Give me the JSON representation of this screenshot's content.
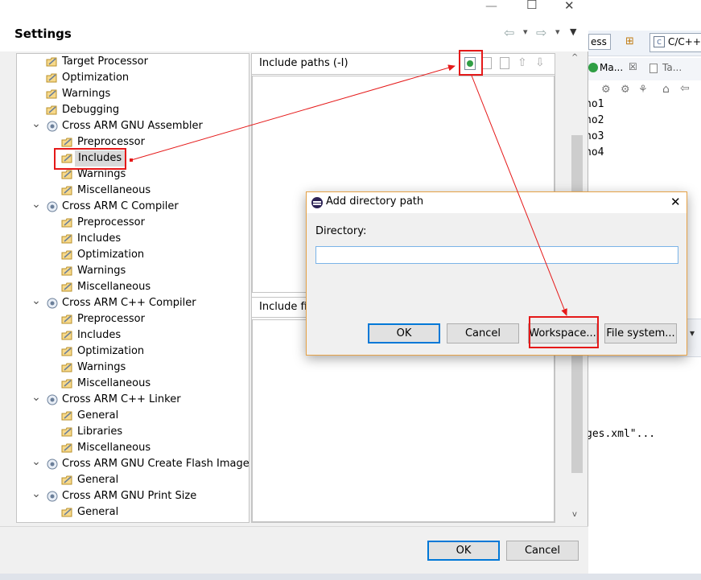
{
  "background_ide": {
    "search_text": "ess",
    "perspective_label": "C/C++",
    "tab1_label": "Ma...",
    "tab1_close": "☒",
    "tab2_label": "Ta...",
    "list_items": [
      "no1",
      "no2",
      "no3",
      "no4"
    ],
    "console_text": "ges.xml\"..."
  },
  "window": {
    "minimize_glyph": "—",
    "maximize_glyph": "☐",
    "close_glyph": "✕"
  },
  "header": {
    "title": "Settings",
    "nav_back_icon": "⇦",
    "nav_forward_icon": "⇨",
    "dropdown_icon": "▾",
    "menu_icon": "▼"
  },
  "tree": {
    "items": [
      {
        "label": "Target Processor",
        "level": 1,
        "expanded": null
      },
      {
        "label": "Optimization",
        "level": 1,
        "expanded": null
      },
      {
        "label": "Warnings",
        "level": 1,
        "expanded": null
      },
      {
        "label": "Debugging",
        "level": 1,
        "expanded": null
      },
      {
        "label": "Cross ARM GNU Assembler",
        "level": 1,
        "expanded": true
      },
      {
        "label": "Preprocessor",
        "level": 2,
        "expanded": null
      },
      {
        "label": "Includes",
        "level": 2,
        "expanded": null,
        "selected": true
      },
      {
        "label": "Warnings",
        "level": 2,
        "expanded": null
      },
      {
        "label": "Miscellaneous",
        "level": 2,
        "expanded": null
      },
      {
        "label": "Cross ARM C Compiler",
        "level": 1,
        "expanded": true
      },
      {
        "label": "Preprocessor",
        "level": 2,
        "expanded": null
      },
      {
        "label": "Includes",
        "level": 2,
        "expanded": null
      },
      {
        "label": "Optimization",
        "level": 2,
        "expanded": null
      },
      {
        "label": "Warnings",
        "level": 2,
        "expanded": null
      },
      {
        "label": "Miscellaneous",
        "level": 2,
        "expanded": null
      },
      {
        "label": "Cross ARM C++ Compiler",
        "level": 1,
        "expanded": true
      },
      {
        "label": "Preprocessor",
        "level": 2,
        "expanded": null
      },
      {
        "label": "Includes",
        "level": 2,
        "expanded": null
      },
      {
        "label": "Optimization",
        "level": 2,
        "expanded": null
      },
      {
        "label": "Warnings",
        "level": 2,
        "expanded": null
      },
      {
        "label": "Miscellaneous",
        "level": 2,
        "expanded": null
      },
      {
        "label": "Cross ARM C++ Linker",
        "level": 1,
        "expanded": true
      },
      {
        "label": "General",
        "level": 2,
        "expanded": null
      },
      {
        "label": "Libraries",
        "level": 2,
        "expanded": null
      },
      {
        "label": "Miscellaneous",
        "level": 2,
        "expanded": null
      },
      {
        "label": "Cross ARM GNU Create Flash Image",
        "level": 1,
        "expanded": true
      },
      {
        "label": "General",
        "level": 2,
        "expanded": null
      },
      {
        "label": "Cross ARM GNU Print Size",
        "level": 1,
        "expanded": true
      },
      {
        "label": "General",
        "level": 2,
        "expanded": null
      }
    ]
  },
  "include_paths": {
    "title": "Include paths (-I)",
    "toolbar_icons": [
      "add-icon",
      "add-from-workspace-icon",
      "edit-icon",
      "move-up-icon",
      "move-down-icon"
    ]
  },
  "include_files": {
    "title": "Include files"
  },
  "footer": {
    "ok_label": "OK",
    "cancel_label": "Cancel"
  },
  "dialog": {
    "title": "Add directory path",
    "close_glyph": "✕",
    "directory_label": "Directory:",
    "directory_value": "",
    "ok_label": "OK",
    "cancel_label": "Cancel",
    "workspace_label": "Workspace...",
    "filesystem_label": "File system..."
  },
  "colors": {
    "annotation_red": "#e51919",
    "focus_blue": "#0078d7",
    "dialog_border": "#e6a247",
    "selection_gray": "#d9d9d9"
  }
}
